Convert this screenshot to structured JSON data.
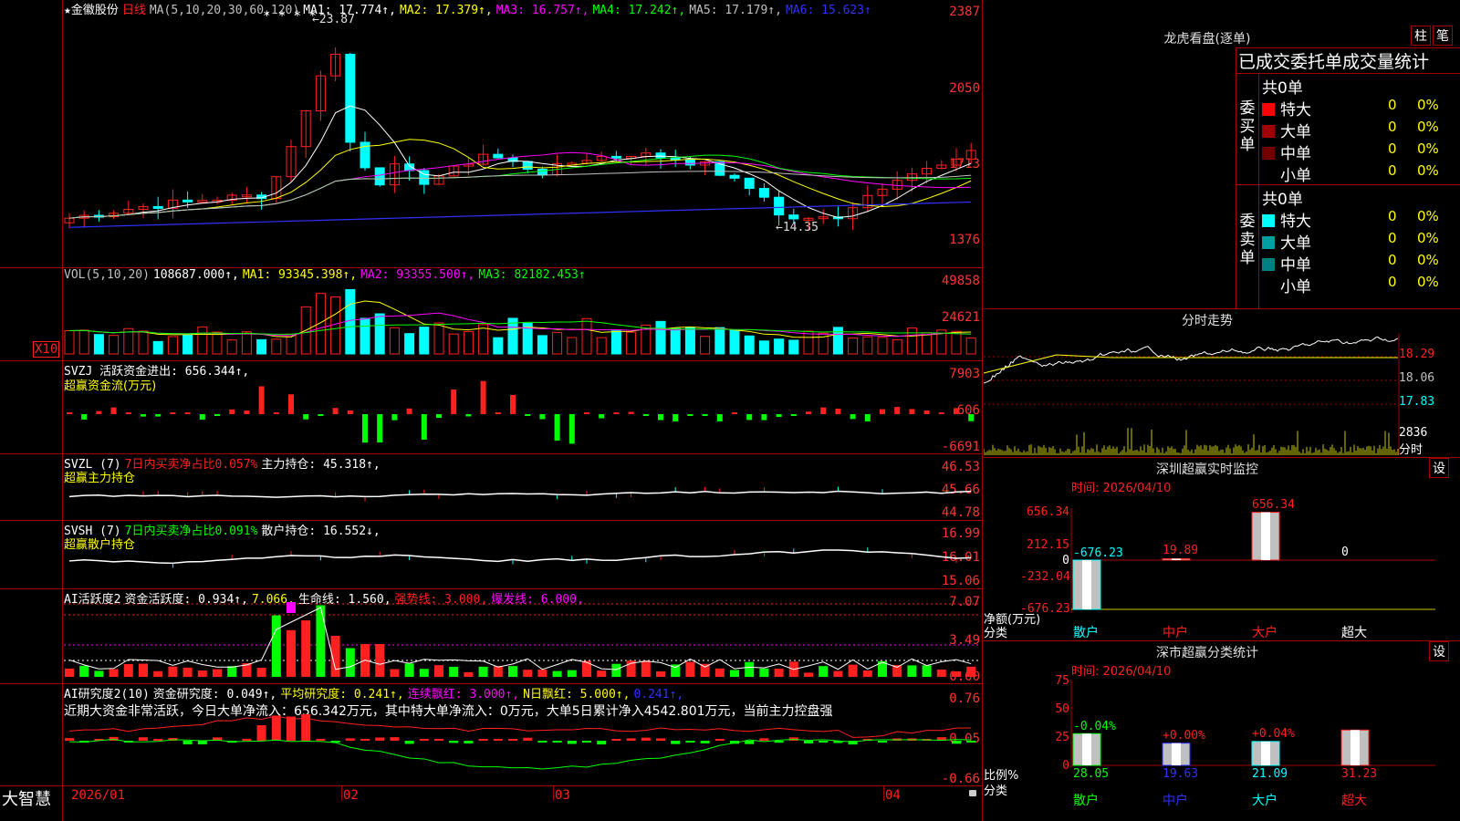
{
  "colors": {
    "up": "#ff2020",
    "down": "#00ffff",
    "grid": "#a00000",
    "ma1": "#ffffff",
    "ma2": "#ffff00",
    "ma3": "#ff00ff",
    "ma4": "#00ff00",
    "ma5": "#c0c0c0",
    "ma6": "#3030ff"
  },
  "main": {
    "stock_name": "★金徽股份",
    "period": "日线",
    "ma_params": "MA(5,10,20,30,60,120)",
    "ma1": "MA1: 17.774↑,",
    "ma2": "MA2: 17.379↑,",
    "ma3": "MA3: 16.757↑,",
    "ma4": "MA4: 17.242↑,",
    "ma5": "MA5: 17.179↑,",
    "ma6": "MA6: 15.623↑",
    "y_labels": [
      "2387",
      "2050",
      "1713",
      "1376"
    ],
    "high_label": "←23.87",
    "low_label": "←14.35",
    "stars": "* * * *"
  },
  "vol": {
    "title": "VOL(5,10,20)",
    "value": "108687.000↑,",
    "ma1": "MA1: 93345.398↑,",
    "ma2": "MA2: 93355.500↑,",
    "ma3": "MA3: 82182.453↑",
    "y_labels": [
      "49858",
      "24621"
    ],
    "unit": "X10"
  },
  "svzj": {
    "title": "SVZJ  活跃资金进出: 656.344↑,",
    "sub": "超赢资金流(万元)",
    "y_labels": [
      "7903",
      "606",
      "-6691"
    ]
  },
  "svzl": {
    "title": "SVZL (7)",
    "pct": "7日内买卖净占比0.057%",
    "hold": "主力持仓: 45.318↑,",
    "sub": "超赢主力持仓",
    "y_labels": [
      "46.53",
      "45.66",
      "44.78"
    ]
  },
  "svsh": {
    "title": "SVSH (7)",
    "pct": "7日内买卖净占比0.091%",
    "hold": "散户持仓: 16.552↓,",
    "sub": "超赢散户持仓",
    "y_labels": [
      "16.99",
      "16.01",
      "15.06"
    ]
  },
  "ai1": {
    "title": "AI活跃度2",
    "v1": "资金活跃度: 0.934↑,",
    "v2": "7.066,",
    "v3": "生命线: 1.560,",
    "v4": "强势线: 3.000,",
    "v5": "爆发线: 6.000,",
    "y_labels": [
      "7.07",
      "3.49",
      "0.00"
    ]
  },
  "ai2": {
    "title": "AI研究度2(10)",
    "v1": "资金研究度: 0.049↑,",
    "v2": "平均研究度: 0.241↑,",
    "v3": "连续飘红: 3.000↑,",
    "v4": "N日飘红: 5.000↑,",
    "v5": "0.241↑,",
    "comment": "近期大资金非常活跃，今日大单净流入：656.342万元，其中特大单净流入：0万元，大单5日累计净入4542.801万元，当前主力控盘强",
    "y_labels": [
      "0.76",
      "0.05",
      "-0.66"
    ]
  },
  "bottom": {
    "logo": "大智慧",
    "dates": [
      "2026/01",
      "02",
      "03",
      "04"
    ]
  },
  "lhb": {
    "title": "龙虎看盘(逐单)",
    "btn1": "柱",
    "btn2": "笔",
    "header": "已成交委托单成交量统计",
    "buy_label": "委买单",
    "sell_label": "委卖单",
    "buy_total": "共0单",
    "sell_total": "共0单",
    "rows": [
      {
        "label": "特大",
        "n": "0",
        "p": "0%"
      },
      {
        "label": "大单",
        "n": "0",
        "p": "0%"
      },
      {
        "label": "中单",
        "n": "0",
        "p": "0%"
      },
      {
        "label": "小单",
        "n": "0",
        "p": "0%"
      }
    ]
  },
  "fenshi": {
    "title": "分时走势",
    "y_labels": [
      "18.29",
      "18.06",
      "17.83"
    ],
    "vol_label": "2836",
    "vol_unit": "分时"
  },
  "monitor": {
    "title": "深圳超赢实时监控",
    "btn": "设",
    "time": "时间: 2026/04/10",
    "y_labels": [
      "656.34",
      "212.15",
      "0",
      "-232.04",
      "-676.23"
    ],
    "categories": [
      "散户",
      "中户",
      "大户",
      "超大"
    ],
    "values": [
      -676.23,
      19.89,
      656.34,
      0
    ],
    "value_labels": [
      "-676.23",
      "19.89",
      "656.34",
      "0"
    ],
    "ylabel": "净额(万元)",
    "xlabel": "分类"
  },
  "classify": {
    "title": "深市超赢分类统计",
    "btn": "设",
    "time": "时间: 2026/04/10",
    "y_labels": [
      "75",
      "50",
      "25",
      "0"
    ],
    "categories": [
      "散户",
      "中户",
      "大户",
      "超大"
    ],
    "values": [
      28.05,
      19.63,
      21.09,
      31.23
    ],
    "changes": [
      "-0.04%",
      "+0.00%",
      "+0.04%",
      ""
    ],
    "ylabel": "比例%",
    "xlabel": "分类"
  }
}
